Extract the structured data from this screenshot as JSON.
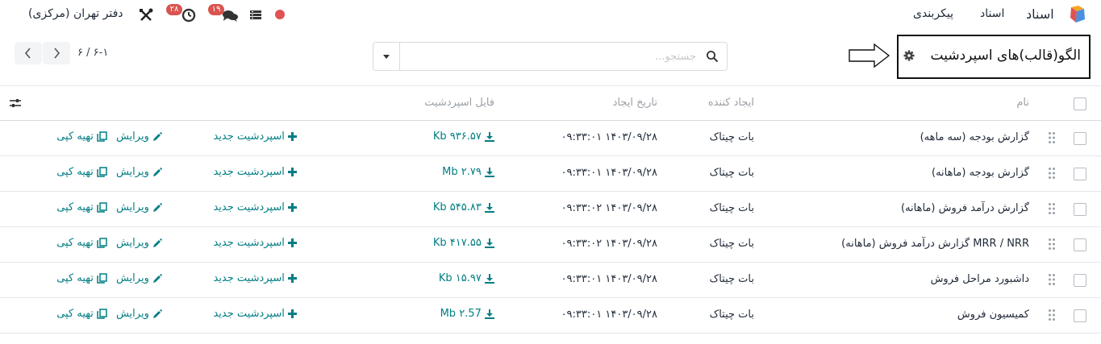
{
  "navbar": {
    "brand": "اسناد",
    "menu": [
      "اسناد",
      "پیکربندی"
    ],
    "company": "دفتر تهران (مرکزی)",
    "messages_count": "۱۹",
    "activities_count": "۲۸",
    "icons": [
      "app-logo",
      "status-dot",
      "table-icon",
      "messages-icon",
      "activity-clock-icon",
      "tools-icon"
    ]
  },
  "control_panel": {
    "title": "الگو(قالب)های اسپردشیت",
    "search_placeholder": "جستجو...",
    "pager": "۶-۱ / ۶"
  },
  "table": {
    "columns": {
      "name": "نام",
      "creator": "ایجاد کننده",
      "created": "تاریخ ایجاد",
      "file": "فایل اسپردشیت"
    },
    "action_labels": {
      "new": "اسپردشیت جدید",
      "edit": "ویرایش",
      "copy": "تهیه کپی"
    },
    "rows": [
      {
        "name": "گزارش بودجه (سه ماهه)",
        "creator": "بات چیتاک",
        "date": "۱۴۰۳/۰۹/۲۸ ۰۹:۳۳:۰۱",
        "file": "Kb ۹۳۶.۵۷"
      },
      {
        "name": "گزارش بودجه (ماهانه)",
        "creator": "بات چیتاک",
        "date": "۱۴۰۳/۰۹/۲۸ ۰۹:۳۳:۰۱",
        "file": "Mb ۲.۷۹"
      },
      {
        "name": "گزارش درآمد فروش (ماهانه)",
        "creator": "بات چیتاک",
        "date": "۱۴۰۳/۰۹/۲۸ ۰۹:۳۳:۰۲",
        "file": "Kb ۵۴۵.۸۳"
      },
      {
        "name": "MRR / NRR گزارش درآمد فروش (ماهانه)",
        "creator": "بات چیتاک",
        "date": "۱۴۰۳/۰۹/۲۸ ۰۹:۳۳:۰۲",
        "file": "Kb ۴۱۷.۵۵"
      },
      {
        "name": "داشبورد مراحل فروش",
        "creator": "بات چیتاک",
        "date": "۱۴۰۳/۰۹/۲۸ ۰۹:۳۳:۰۱",
        "file": "Kb ۱۵.۹۷"
      },
      {
        "name": "کمیسیون فروش",
        "creator": "بات چیتاک",
        "date": "۱۴۰۳/۰۹/۲۸ ۰۹:۳۳:۰۱",
        "file": "Mb ۲.57"
      }
    ]
  },
  "colors": {
    "link": "#017e84",
    "badge": "#d9534f",
    "status_dot": "#e05353"
  }
}
